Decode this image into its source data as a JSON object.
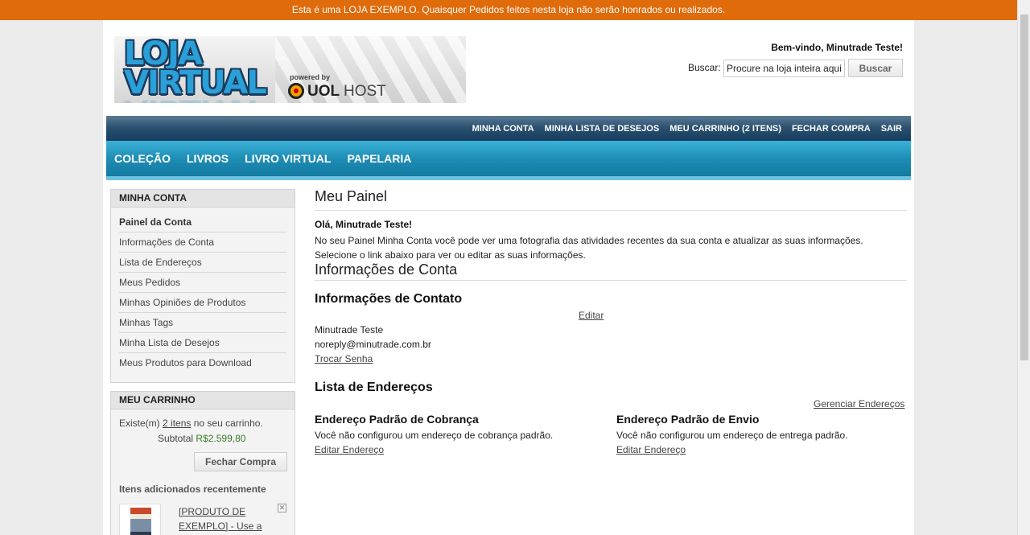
{
  "notice": "Esta é uma LOJA EXEMPLO. Quaisquer Pedidos feitos nesta loja não serão honrados ou realizados.",
  "logo": {
    "title_line1": "LOJA",
    "title_line2": "VIRTUAL",
    "powered_by": "powered by",
    "brand_uol": "UOL",
    "brand_host": "HOST"
  },
  "header": {
    "welcome": "Bem-vindo, Minutrade Teste!",
    "search_label": "Buscar:",
    "search_placeholder": "Procure na loja inteira aqui",
    "search_button": "Buscar"
  },
  "top_links": [
    "MINHA CONTA",
    "MINHA LISTA DE DESEJOS",
    "MEU CARRINHO (2 ITENS)",
    "FECHAR COMPRA",
    "SAIR"
  ],
  "categories": [
    "COLEÇÃO",
    "LIVROS",
    "LIVRO VIRTUAL",
    "PAPELARIA"
  ],
  "sidebar": {
    "account_title": "MINHA CONTA",
    "account_items": [
      "Painel da Conta",
      "Informações de Conta",
      "Lista de Endereços",
      "Meus Pedidos",
      "Minhas Opiniões de Produtos",
      "Minhas Tags",
      "Minha Lista de Desejos",
      "Meus Produtos para Download"
    ],
    "cart_title": "MEU CARRINHO",
    "cart_prefix": "Existe(m)",
    "cart_items_link": "2 itens",
    "cart_suffix": "no seu carrinho.",
    "subtotal_label": "Subtotal",
    "subtotal_value": "R$2.599,80",
    "checkout_button": "Fechar Compra",
    "recent_title": "Itens adicionados recentemente",
    "recent_product": "[PRODUTO DE EXEMPLO] - Use a"
  },
  "main": {
    "page_title": "Meu Painel",
    "hello": "Olá, Minutrade Teste!",
    "intro": "No seu Painel Minha Conta você pode ver uma fotografia das atividades recentes da sua conta e atualizar as suas informações. Selecione o link abaixo para ver ou editar as suas informações.",
    "account_info_title": "Informações de Conta",
    "contact_title": "Informações de Contato",
    "edit_link": "Editar",
    "contact_name": "Minutrade Teste",
    "contact_email": "noreply@minutrade.com.br",
    "change_password": "Trocar Senha",
    "address_title": "Lista de Endereços",
    "manage_addresses": "Gerenciar Endereços",
    "billing_title": "Endereço Padrão de Cobrança",
    "billing_text": "Você não configurou um endereço de cobrança padrão.",
    "billing_edit": "Editar Endereço",
    "shipping_title": "Endereço Padrão de Envio",
    "shipping_text": "Você não configurou um endereço de entrega padrão.",
    "shipping_edit": "Editar Endereço"
  }
}
